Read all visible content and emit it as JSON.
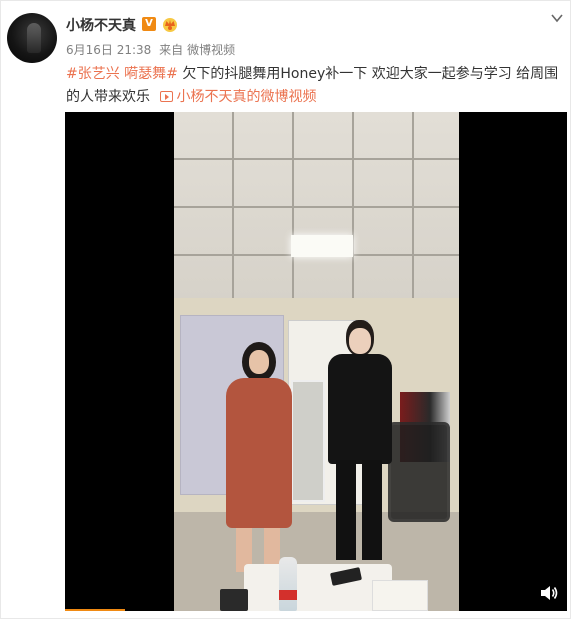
{
  "post": {
    "username": "小杨不天真",
    "verified_badge": "V",
    "date": "6月16日 21:38",
    "source_prefix": "来自",
    "source": "微博视频",
    "topics": [
      "#张艺兴 嗬瑟舞#"
    ],
    "body_text": "欠下的抖腿舞用Honey补一下 欢迎大家一起参与学习 给周围的人带来欢乐",
    "video_link_label": "小杨不天真的微博视频"
  },
  "icons": {
    "avatar": "avatar",
    "verified": "verified-v-icon",
    "crown": "crown-icon",
    "menu": "chevron-down-icon",
    "video_link": "video-play-icon",
    "volume": "volume-icon"
  },
  "colors": {
    "link": "#eb7350",
    "meta": "#808080",
    "badge": "#f08a13"
  },
  "video": {
    "progress_fraction": 0.12
  }
}
